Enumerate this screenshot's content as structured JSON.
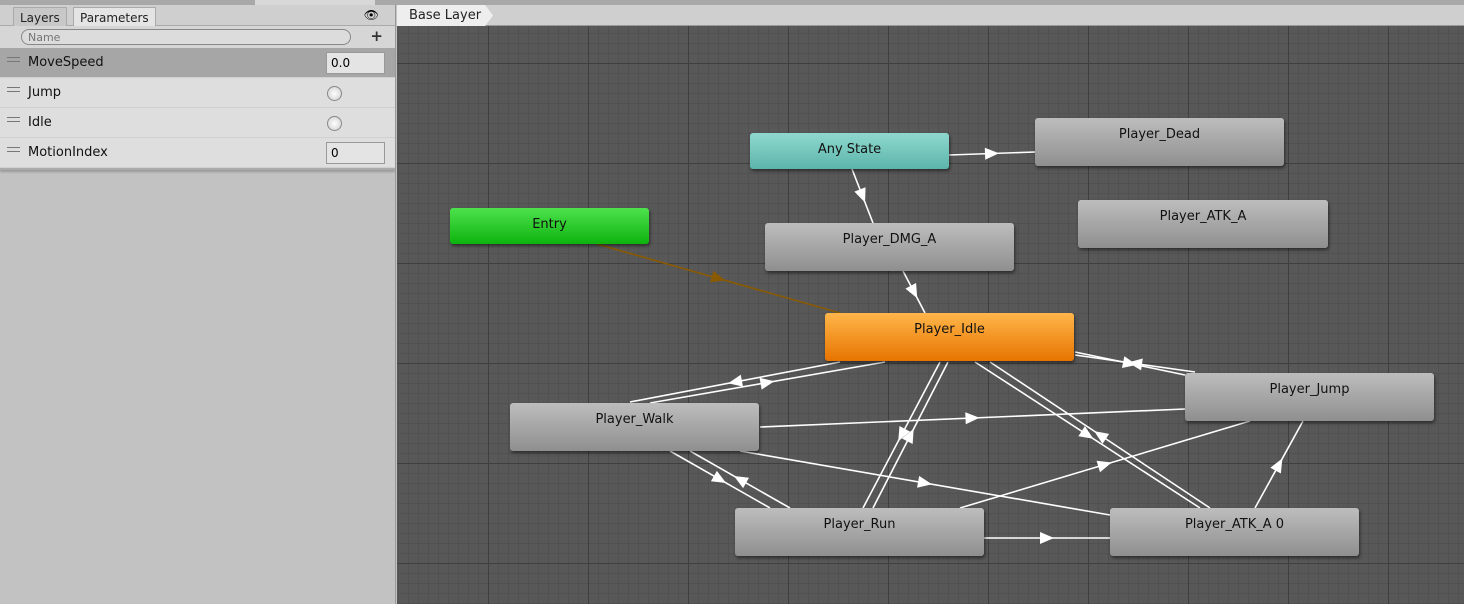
{
  "left_panel": {
    "tabs": [
      {
        "label": "Layers"
      },
      {
        "label": "Parameters",
        "active": true
      }
    ],
    "visibility_icon": "eye-icon",
    "search": {
      "placeholder": "Name",
      "icon": "search-icon"
    },
    "add_icon": "plus-icon",
    "parameters": [
      {
        "name": "MoveSpeed",
        "type": "float",
        "value": "0.0",
        "selected": true
      },
      {
        "name": "Jump",
        "type": "trigger"
      },
      {
        "name": "Idle",
        "type": "trigger"
      },
      {
        "name": "MotionIndex",
        "type": "int",
        "value": "0"
      }
    ]
  },
  "breadcrumb": {
    "label": "Base Layer"
  },
  "graph": {
    "colors": {
      "any_state": "#6cc4ba",
      "entry": "#22c822",
      "default_state": "#f08a10",
      "state": "#a6a6a6",
      "transition": "#ffffff",
      "entry_transition": "#8a5a00"
    },
    "states": [
      {
        "id": "any",
        "label": "Any State"
      },
      {
        "id": "dead",
        "label": "Player_Dead"
      },
      {
        "id": "entry",
        "label": "Entry"
      },
      {
        "id": "atk",
        "label": "Player_ATK_A"
      },
      {
        "id": "dmg",
        "label": "Player_DMG_A"
      },
      {
        "id": "idle",
        "label": "Player_Idle",
        "default": true
      },
      {
        "id": "jump",
        "label": "Player_Jump"
      },
      {
        "id": "walk",
        "label": "Player_Walk"
      },
      {
        "id": "run",
        "label": "Player_Run"
      },
      {
        "id": "atk0",
        "label": "Player_ATK_A 0"
      }
    ],
    "transitions": [
      {
        "from": "any",
        "to": "dead"
      },
      {
        "from": "any",
        "to": "dmg"
      },
      {
        "from": "dmg",
        "to": "idle"
      },
      {
        "from": "entry",
        "to": "idle"
      },
      {
        "from": "idle",
        "to": "walk"
      },
      {
        "from": "walk",
        "to": "idle"
      },
      {
        "from": "idle",
        "to": "jump"
      },
      {
        "from": "jump",
        "to": "idle"
      },
      {
        "from": "walk",
        "to": "jump"
      },
      {
        "from": "idle",
        "to": "run"
      },
      {
        "from": "run",
        "to": "idle"
      },
      {
        "from": "idle",
        "to": "atk0"
      },
      {
        "from": "atk0",
        "to": "idle"
      },
      {
        "from": "walk",
        "to": "run"
      },
      {
        "from": "run",
        "to": "walk"
      },
      {
        "from": "walk",
        "to": "atk0"
      },
      {
        "from": "run",
        "to": "jump"
      },
      {
        "from": "run",
        "to": "atk0"
      },
      {
        "from": "atk0",
        "to": "jump"
      }
    ]
  }
}
